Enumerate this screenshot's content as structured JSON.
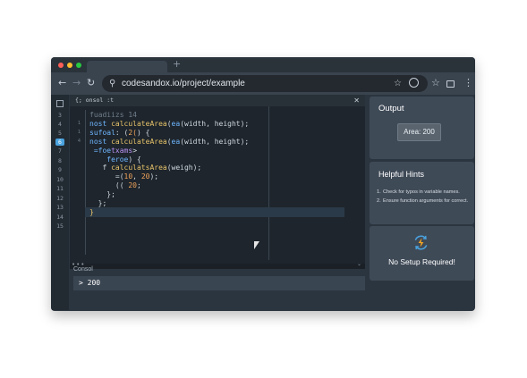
{
  "browser": {
    "url": "codesandox.io/project/example",
    "new_tab_symbol": "+",
    "icons": [
      "back-arrow-icon",
      "forward-arrow-icon",
      "reload-icon",
      "search-icon",
      "bookmark-star-icon",
      "extension-icon",
      "window-icon",
      "menu-icon"
    ]
  },
  "gutter_lines": [
    "3",
    "4",
    "5",
    "6",
    "7",
    "8",
    "9",
    "10",
    "11",
    "12",
    "13",
    "14",
    "15"
  ],
  "editor": {
    "file_tab": "{; onsol :t",
    "code": [
      {
        "gutter": "",
        "tokens": [
          [
            "muted",
            "fuadiizs 14"
          ]
        ]
      },
      {
        "gutter": "1",
        "tokens": [
          [
            "kw",
            "nost "
          ],
          [
            "fn",
            "calculateArea"
          ],
          [
            "plain",
            "("
          ],
          [
            "kw",
            "ea"
          ],
          [
            "plain",
            "(width, height);"
          ]
        ]
      },
      {
        "gutter": "1",
        "tokens": [
          [
            "kw",
            "sufoal"
          ],
          [
            "plain",
            ": ("
          ],
          [
            "num",
            "2("
          ],
          [
            "plain",
            ") {"
          ]
        ]
      },
      {
        "gutter": "4",
        "tokens": [
          [
            "kw",
            "nost "
          ],
          [
            "fn",
            "calculateArea"
          ],
          [
            "plain",
            "("
          ],
          [
            "kw",
            "ea"
          ],
          [
            "plain",
            "(width, height);"
          ]
        ]
      },
      {
        "gutter": "",
        "tokens": [
          [
            "plain",
            " "
          ],
          [
            "kw",
            "=foe"
          ],
          [
            "pur",
            "txams"
          ],
          [
            "plain",
            ">"
          ]
        ]
      },
      {
        "gutter": "",
        "tokens": [
          [
            "plain",
            "    "
          ],
          [
            "kw",
            "feroe"
          ],
          [
            "plain",
            ") {"
          ]
        ]
      },
      {
        "gutter": "",
        "tokens": [
          [
            "plain",
            "   f "
          ],
          [
            "fn",
            "calculatsArea"
          ],
          [
            "plain",
            "(weigh);"
          ]
        ]
      },
      {
        "gutter": "",
        "tokens": [
          [
            "plain",
            "      =("
          ],
          [
            "num",
            "10"
          ],
          [
            "plain",
            ", "
          ],
          [
            "num",
            "20"
          ],
          [
            "plain",
            ");"
          ]
        ]
      },
      {
        "gutter": "",
        "tokens": [
          [
            "plain",
            "      (( "
          ],
          [
            "num",
            "20"
          ],
          [
            "plain",
            ";"
          ]
        ]
      },
      {
        "gutter": "",
        "tokens": [
          [
            "plain",
            "    };"
          ]
        ]
      },
      {
        "gutter": "",
        "tokens": [
          [
            "plain",
            "  };"
          ]
        ]
      },
      {
        "gutter": "",
        "tokens": [
          [
            "br",
            "}"
          ]
        ]
      }
    ]
  },
  "console": {
    "label": "Consol",
    "output": "> 200"
  },
  "output_panel": {
    "title": "Output",
    "value": "Area: 200"
  },
  "hints_panel": {
    "title": "Helpful Hints",
    "items": [
      {
        "num": "1.",
        "text": "Check for typos in variable names."
      },
      {
        "num": "2.",
        "text": "Ensure function arguments for correct."
      }
    ]
  },
  "setup_panel": {
    "text": "No Setup Required!",
    "icon": "lightning-sync-icon"
  },
  "colors": {
    "accent": "#4aa3df",
    "panel": "#3f4a57",
    "editor_bg": "#1e252c"
  }
}
